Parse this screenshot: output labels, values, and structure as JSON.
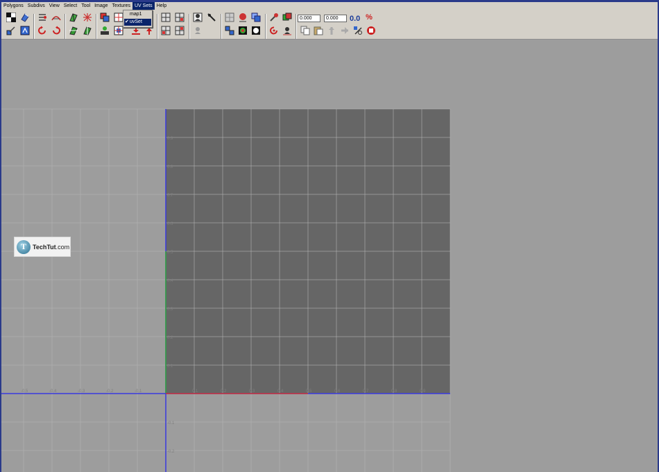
{
  "menu": {
    "items": [
      "Polygons",
      "Subdivs",
      "View",
      "Select",
      "Tool",
      "Image",
      "Textures",
      "UV Sets",
      "Help"
    ],
    "active_index": 7
  },
  "uv_sets_menu": {
    "items": [
      {
        "label": "map1",
        "checked": false,
        "selected": false
      },
      {
        "label": "uvSet",
        "checked": true,
        "selected": true
      }
    ]
  },
  "toolbar": {
    "field_1": "0.000",
    "field_2": "0.000",
    "zero_label": "0.0",
    "percent_label": "%"
  },
  "icons": [
    "checker-icon",
    "cube-unfold-icon",
    "align-icon",
    "uv-snapshot-icon",
    "rotate-ccw-icon",
    "rotate-cw-icon",
    "flip-u-icon",
    "flip-v-icon",
    "unfold-icon",
    "layout-icon",
    "cut-uv-icon",
    "sew-uv-icon",
    "move-uv-icon",
    "grid-icon",
    "pin-icon",
    "unpin-icon",
    "dim-image-icon",
    "shade-uv-icon",
    "texture-border-icon",
    "copy-uv-icon",
    "paste-uv-icon",
    "cycle-uv-icon",
    "isolate-icon"
  ],
  "editor": {
    "colors": {
      "background": "#9d9d9d",
      "uv_square": "#666666",
      "grid": "#b3b3b3",
      "axis_u": "#cc3333",
      "axis_v": "#3a3adf",
      "axis_v_inner": "#33aa33"
    },
    "u_tick_labels_pos": [
      "0.1",
      "0.2",
      "0.3",
      "0.4",
      "0.5",
      "0.6",
      "0.7",
      "0.8",
      "0.9"
    ],
    "u_tick_labels_neg": [
      "-0.5",
      "-0.4",
      "-0.3",
      "-0.2",
      "-0.1"
    ],
    "v_tick_labels_pos": [
      "0.9",
      "0.8",
      "0.7",
      "0.6",
      "0.5",
      "0.4",
      "0.3",
      "0.2",
      "0.1"
    ],
    "v_tick_labels_neg": [
      "-0.1",
      "-0.2"
    ]
  },
  "watermark": {
    "logo_letter": "T",
    "brand_bold": "TechTut",
    "brand_suffix": ".com"
  }
}
